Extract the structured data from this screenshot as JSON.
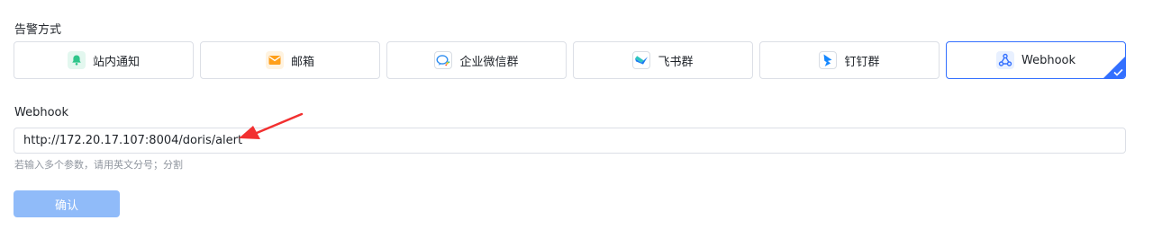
{
  "alert_methods": {
    "label": "告警方式",
    "items": [
      {
        "label": "站内通知",
        "icon": "bell-icon",
        "selected": false
      },
      {
        "label": "邮箱",
        "icon": "mail-icon",
        "selected": false
      },
      {
        "label": "企业微信群",
        "icon": "wecom-icon",
        "selected": false
      },
      {
        "label": "飞书群",
        "icon": "feishu-icon",
        "selected": false
      },
      {
        "label": "钉钉群",
        "icon": "dingtalk-icon",
        "selected": false
      },
      {
        "label": "Webhook",
        "icon": "webhook-icon",
        "selected": true
      }
    ]
  },
  "webhook": {
    "label": "Webhook",
    "value": "http://172.20.17.107:8004/doris/alert",
    "hint": "若输入多个参数，请用英文分号；分割"
  },
  "confirm_button": {
    "label": "确认"
  },
  "colors": {
    "accent": "#3370ff",
    "button_disabled": "#90bbf9",
    "annotation_arrow": "#f23030"
  }
}
